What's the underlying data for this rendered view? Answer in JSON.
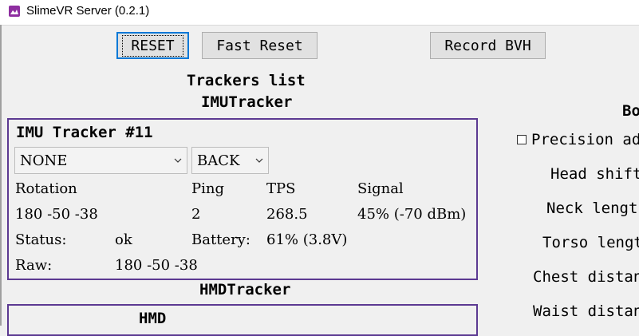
{
  "window": {
    "title": "SlimeVR Server (0.2.1)"
  },
  "toolbar": {
    "reset_label": "RESET",
    "fast_reset_label": "Fast Reset",
    "record_bvh_label": "Record BVH"
  },
  "trackers": {
    "title": "Trackers list",
    "imu_section_title": "IMUTracker",
    "hmd_section_title": "HMDTracker"
  },
  "imu_tracker": {
    "name": "IMU Tracker #11",
    "mount_select": "NONE",
    "position_select": "BACK",
    "headers": {
      "rotation": "Rotation",
      "ping": "Ping",
      "tps": "TPS",
      "signal": "Signal"
    },
    "values": {
      "rotation": "180 -50 -38",
      "ping": "2",
      "tps": "268.5",
      "signal": "45% (-70 dBm)"
    },
    "status_label": "Status:",
    "status_value": "ok",
    "battery_label": "Battery:",
    "battery_value": "61% (3.8V)",
    "raw_label": "Raw:",
    "raw_value": "180 -50 -38"
  },
  "hmd_tracker": {
    "name": "HMD"
  },
  "body_config": {
    "title_partial": "Bo",
    "precision_label": "Precision adj",
    "items": [
      "Head shift",
      "Neck length",
      "Torso lengt",
      "Chest distan",
      "Waist distan"
    ]
  },
  "colors": {
    "accent": "#5c3a92",
    "focus": "#0078d7",
    "app_icon": "#8e2ea0"
  }
}
